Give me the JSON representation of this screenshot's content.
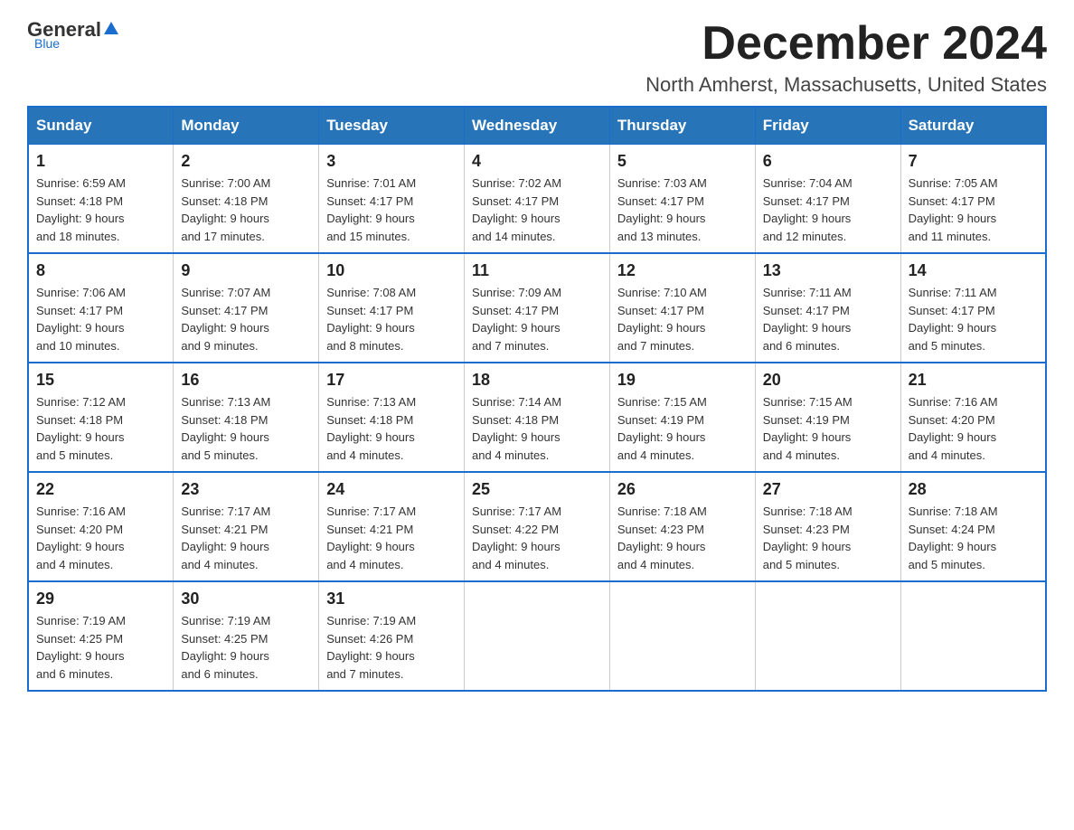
{
  "logo": {
    "general": "General",
    "blue": "Blue",
    "underline": "Blue"
  },
  "title": {
    "month": "December 2024",
    "location": "North Amherst, Massachusetts, United States"
  },
  "headers": [
    "Sunday",
    "Monday",
    "Tuesday",
    "Wednesday",
    "Thursday",
    "Friday",
    "Saturday"
  ],
  "weeks": [
    [
      {
        "num": "1",
        "sunrise": "6:59 AM",
        "sunset": "4:18 PM",
        "daylight": "9 hours and 18 minutes."
      },
      {
        "num": "2",
        "sunrise": "7:00 AM",
        "sunset": "4:18 PM",
        "daylight": "9 hours and 17 minutes."
      },
      {
        "num": "3",
        "sunrise": "7:01 AM",
        "sunset": "4:17 PM",
        "daylight": "9 hours and 15 minutes."
      },
      {
        "num": "4",
        "sunrise": "7:02 AM",
        "sunset": "4:17 PM",
        "daylight": "9 hours and 14 minutes."
      },
      {
        "num": "5",
        "sunrise": "7:03 AM",
        "sunset": "4:17 PM",
        "daylight": "9 hours and 13 minutes."
      },
      {
        "num": "6",
        "sunrise": "7:04 AM",
        "sunset": "4:17 PM",
        "daylight": "9 hours and 12 minutes."
      },
      {
        "num": "7",
        "sunrise": "7:05 AM",
        "sunset": "4:17 PM",
        "daylight": "9 hours and 11 minutes."
      }
    ],
    [
      {
        "num": "8",
        "sunrise": "7:06 AM",
        "sunset": "4:17 PM",
        "daylight": "9 hours and 10 minutes."
      },
      {
        "num": "9",
        "sunrise": "7:07 AM",
        "sunset": "4:17 PM",
        "daylight": "9 hours and 9 minutes."
      },
      {
        "num": "10",
        "sunrise": "7:08 AM",
        "sunset": "4:17 PM",
        "daylight": "9 hours and 8 minutes."
      },
      {
        "num": "11",
        "sunrise": "7:09 AM",
        "sunset": "4:17 PM",
        "daylight": "9 hours and 7 minutes."
      },
      {
        "num": "12",
        "sunrise": "7:10 AM",
        "sunset": "4:17 PM",
        "daylight": "9 hours and 7 minutes."
      },
      {
        "num": "13",
        "sunrise": "7:11 AM",
        "sunset": "4:17 PM",
        "daylight": "9 hours and 6 minutes."
      },
      {
        "num": "14",
        "sunrise": "7:11 AM",
        "sunset": "4:17 PM",
        "daylight": "9 hours and 5 minutes."
      }
    ],
    [
      {
        "num": "15",
        "sunrise": "7:12 AM",
        "sunset": "4:18 PM",
        "daylight": "9 hours and 5 minutes."
      },
      {
        "num": "16",
        "sunrise": "7:13 AM",
        "sunset": "4:18 PM",
        "daylight": "9 hours and 5 minutes."
      },
      {
        "num": "17",
        "sunrise": "7:13 AM",
        "sunset": "4:18 PM",
        "daylight": "9 hours and 4 minutes."
      },
      {
        "num": "18",
        "sunrise": "7:14 AM",
        "sunset": "4:18 PM",
        "daylight": "9 hours and 4 minutes."
      },
      {
        "num": "19",
        "sunrise": "7:15 AM",
        "sunset": "4:19 PM",
        "daylight": "9 hours and 4 minutes."
      },
      {
        "num": "20",
        "sunrise": "7:15 AM",
        "sunset": "4:19 PM",
        "daylight": "9 hours and 4 minutes."
      },
      {
        "num": "21",
        "sunrise": "7:16 AM",
        "sunset": "4:20 PM",
        "daylight": "9 hours and 4 minutes."
      }
    ],
    [
      {
        "num": "22",
        "sunrise": "7:16 AM",
        "sunset": "4:20 PM",
        "daylight": "9 hours and 4 minutes."
      },
      {
        "num": "23",
        "sunrise": "7:17 AM",
        "sunset": "4:21 PM",
        "daylight": "9 hours and 4 minutes."
      },
      {
        "num": "24",
        "sunrise": "7:17 AM",
        "sunset": "4:21 PM",
        "daylight": "9 hours and 4 minutes."
      },
      {
        "num": "25",
        "sunrise": "7:17 AM",
        "sunset": "4:22 PM",
        "daylight": "9 hours and 4 minutes."
      },
      {
        "num": "26",
        "sunrise": "7:18 AM",
        "sunset": "4:23 PM",
        "daylight": "9 hours and 4 minutes."
      },
      {
        "num": "27",
        "sunrise": "7:18 AM",
        "sunset": "4:23 PM",
        "daylight": "9 hours and 5 minutes."
      },
      {
        "num": "28",
        "sunrise": "7:18 AM",
        "sunset": "4:24 PM",
        "daylight": "9 hours and 5 minutes."
      }
    ],
    [
      {
        "num": "29",
        "sunrise": "7:19 AM",
        "sunset": "4:25 PM",
        "daylight": "9 hours and 6 minutes."
      },
      {
        "num": "30",
        "sunrise": "7:19 AM",
        "sunset": "4:25 PM",
        "daylight": "9 hours and 6 minutes."
      },
      {
        "num": "31",
        "sunrise": "7:19 AM",
        "sunset": "4:26 PM",
        "daylight": "9 hours and 7 minutes."
      },
      null,
      null,
      null,
      null
    ]
  ]
}
